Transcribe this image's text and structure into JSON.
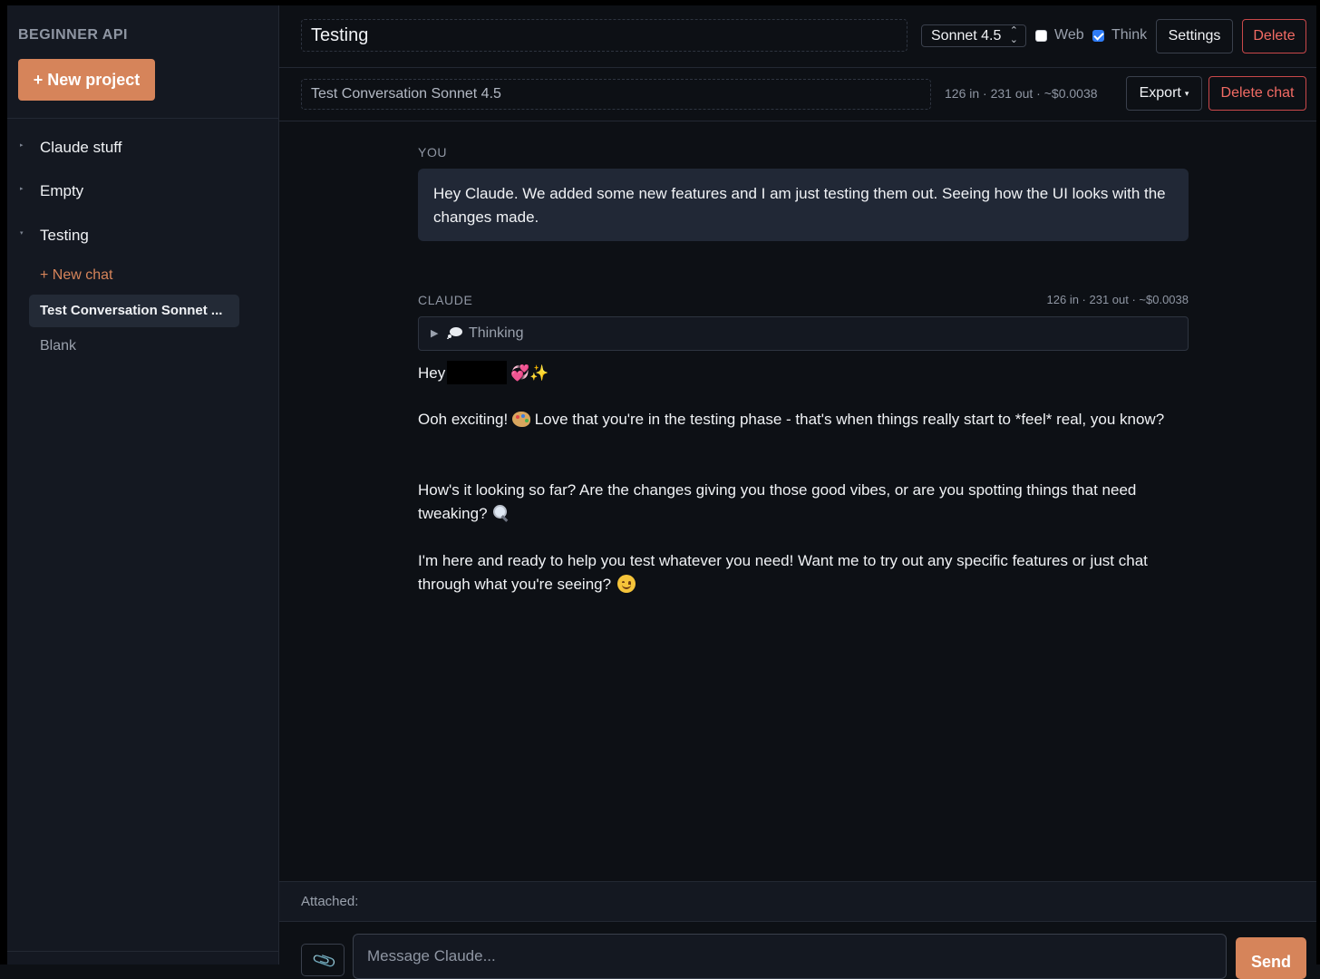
{
  "sidebar": {
    "brand": "BEGINNER API",
    "new_project_label": "+ New project",
    "projects": [
      {
        "label": "Claude stuff",
        "caret": "▸"
      },
      {
        "label": "Empty",
        "caret": "▸"
      },
      {
        "label": "Testing",
        "caret": "▾"
      }
    ],
    "new_chat_label": "+ New chat",
    "chats": [
      {
        "label": "Test Conversation Sonnet ...",
        "active": true
      },
      {
        "label": "Blank",
        "active": false
      }
    ]
  },
  "header": {
    "project_title": "Testing",
    "model": "Sonnet 4.5",
    "web_label": "Web",
    "web_checked": false,
    "think_label": "Think",
    "think_checked": true,
    "settings_label": "Settings",
    "delete_label": "Delete"
  },
  "chat_bar": {
    "chat_title": "Test Conversation Sonnet 4.5",
    "usage": "126 in · 231 out · ~$0.0038",
    "export_label": "Export",
    "delete_chat_label": "Delete chat"
  },
  "messages": {
    "user": {
      "role": "YOU",
      "text": "Hey Claude. We added some new features and I am just testing them out. Seeing how the UI looks with the changes made."
    },
    "assistant": {
      "role": "CLAUDE",
      "usage": "126 in · 231 out · ~$0.0038",
      "thinking_label": "Thinking",
      "greeting": "Hey",
      "greeting_emoji": "💞✨",
      "p1_a": "Ooh exciting!",
      "p1_b": "Love that you're in the testing phase - that's when things really start to *feel* real, you know?",
      "p2": "How's it looking so far? Are the changes giving you those good vibes, or are you spotting things that need tweaking?",
      "p3": "I'm here and ready to help you test whatever you need! Want me to try out any specific features or just chat through what you're seeing?"
    }
  },
  "composer": {
    "attached_label": "Attached:",
    "placeholder": "Message Claude...",
    "send_label": "Send"
  },
  "colors": {
    "accent": "#d6845a",
    "danger": "#f26b64",
    "background": "#0d1015",
    "sidebar": "#141821",
    "user_bubble": "#212836",
    "checkbox_checked": "#2f7cf6"
  }
}
